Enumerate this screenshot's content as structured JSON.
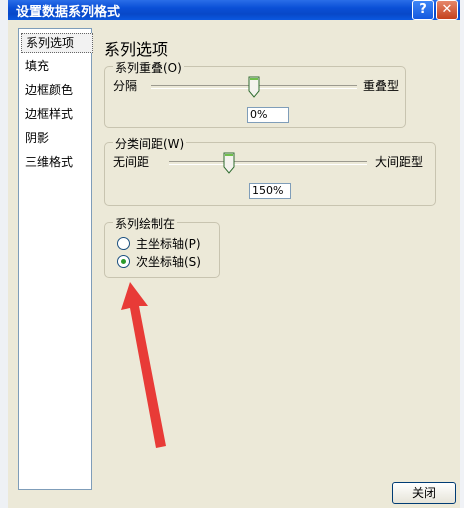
{
  "dialog": {
    "title": "设置数据系列格式",
    "help_button": "?",
    "close_x": "✕",
    "close_label": "关闭"
  },
  "nav": {
    "items": [
      {
        "label": "系列选项",
        "selected": true
      },
      {
        "label": "填充"
      },
      {
        "label": "边框颜色"
      },
      {
        "label": "边框样式"
      },
      {
        "label": "阴影"
      },
      {
        "label": "三维格式"
      }
    ]
  },
  "section_title": "系列选项",
  "overlap": {
    "legend": "系列重叠(O)",
    "left_label": "分隔",
    "right_label": "重叠型",
    "value": "0%",
    "fraction": 0.5
  },
  "gap": {
    "legend": "分类间距(W)",
    "left_label": "无间距",
    "right_label": "大间距型",
    "value": "150%",
    "fraction": 0.3
  },
  "plot_on": {
    "legend": "系列绘制在",
    "options": [
      {
        "label": "主坐标轴(P)",
        "checked": false
      },
      {
        "label": "次坐标轴(S)",
        "checked": true
      }
    ]
  },
  "colors": {
    "titlebar": "#0a4fd6",
    "annotation_arrow": "#e8322e"
  }
}
